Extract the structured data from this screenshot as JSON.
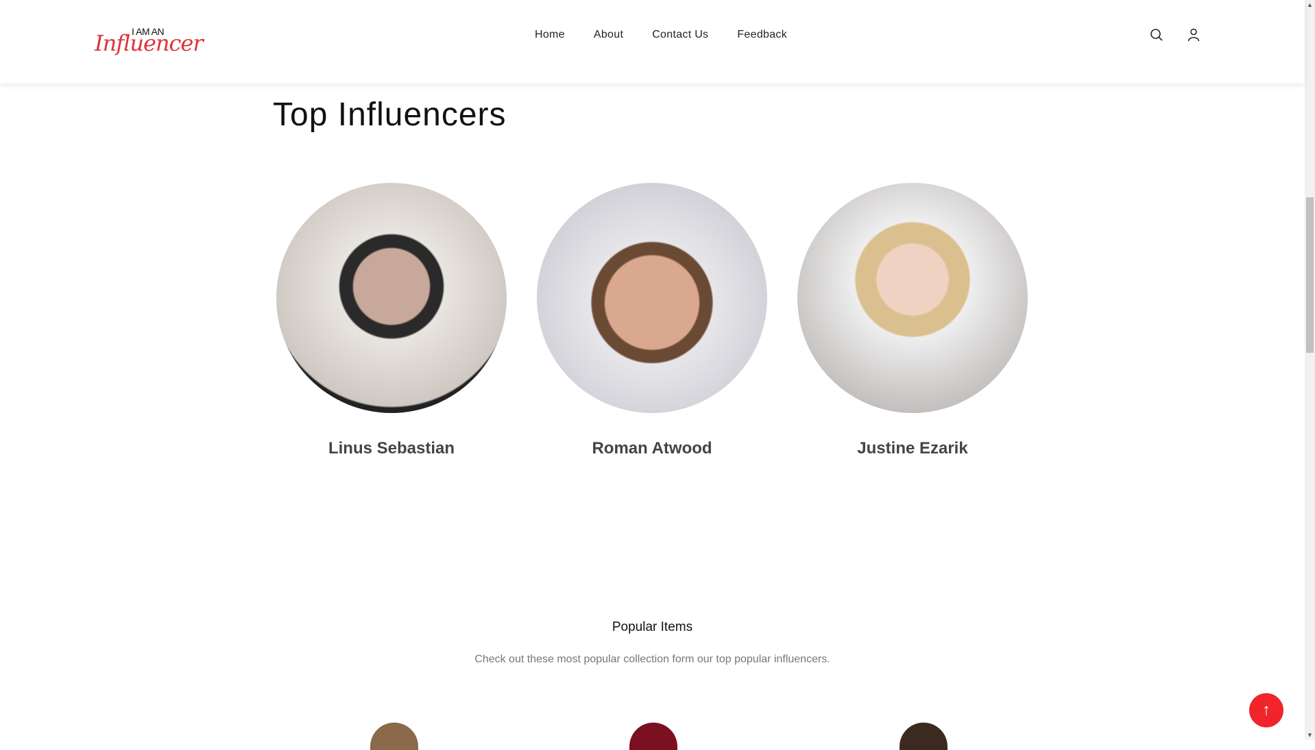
{
  "header": {
    "logo": {
      "top": "I AM AN",
      "script": "Influencer"
    },
    "nav": [
      "Home",
      "About",
      "Contact Us",
      "Feedback"
    ],
    "icons": [
      "search-icon",
      "user-icon"
    ]
  },
  "main": {
    "title": "Top Influencers",
    "influencers": [
      {
        "name": "Linus Sebastian"
      },
      {
        "name": "Roman Atwood"
      },
      {
        "name": "Justine Ezarik"
      }
    ],
    "popular": {
      "title": "Popular Items",
      "subtitle": "Check out these most popular collection form our top popular influencers."
    }
  },
  "back_to_top": {
    "icon": "arrow-up-icon",
    "glyph": "↑",
    "color": "#f0242a"
  }
}
